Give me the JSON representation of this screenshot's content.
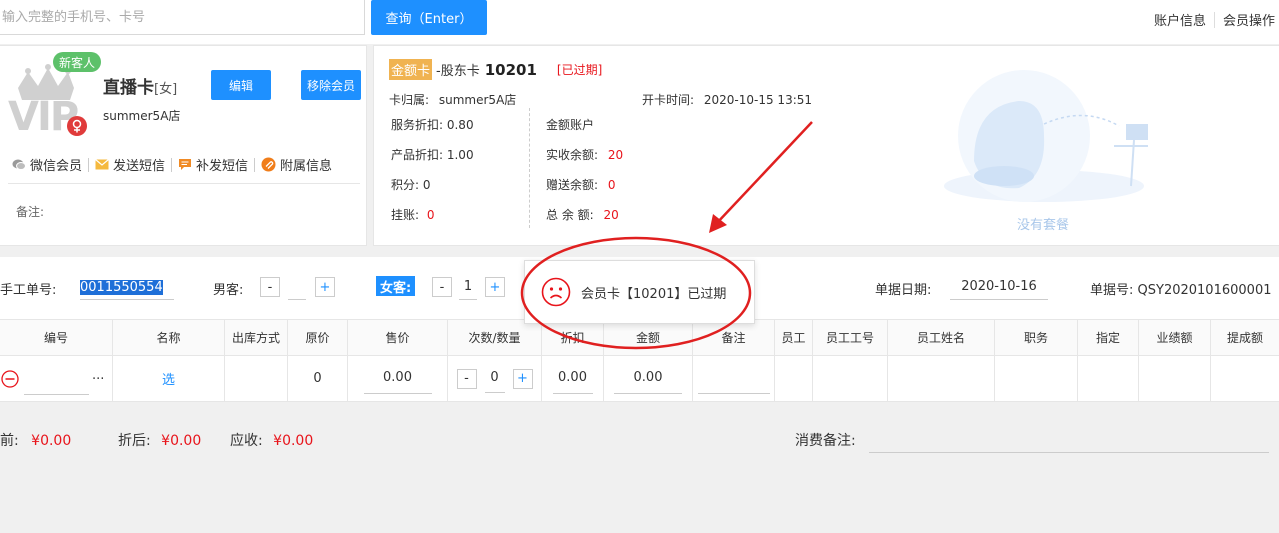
{
  "topbar": {
    "search_placeholder": "输入完整的手机号、卡号",
    "query_button": "查询（Enter）",
    "links": [
      "账户信息",
      "会员操作"
    ]
  },
  "member": {
    "badge": "新客人",
    "logo_text": "VIP",
    "name": "直播卡",
    "gender": "[女]",
    "store": "summer5A店",
    "edit_button": "编辑",
    "remove_button": "移除会员",
    "actions": [
      "微信会员",
      "发送短信",
      "补发短信",
      "附属信息"
    ],
    "remark_label": "备注:"
  },
  "card": {
    "type_tag": "金额卡",
    "card_class": "-股东卡",
    "card_no": "10201",
    "status": "[已过期]",
    "belong_label": "卡归属:",
    "belong_value": "summer5A店",
    "open_time_label": "开卡时间:",
    "open_time_value": "2020-10-15 13:51",
    "service_discount": "服务折扣: 0.80",
    "product_discount": "产品折扣: 1.00",
    "points": "积分: 0",
    "debt_label": "挂账:",
    "debt_value": "0",
    "account_title": "金额账户",
    "paid_label": "实收余额:",
    "paid_value": "20",
    "gift_label": "赠送余额:",
    "gift_value": "0",
    "total_label": "总 余 额:",
    "total_value": "20",
    "no_package": "没有套餐"
  },
  "form": {
    "manual_label": "手工单号:",
    "manual_value": "0011550554",
    "male_label": "男客:",
    "male_value": "",
    "female_label": "女客:",
    "female_value": "1",
    "minus": "-",
    "plus": "+",
    "date_label": "单据日期:",
    "date_value": "2020-10-16",
    "bill_label": "单据号:",
    "bill_value": "QSY2020101600001"
  },
  "table": {
    "headers": [
      "编号",
      "名称",
      "出库方式",
      "原价",
      "售价",
      "次数/数量",
      "折扣",
      "金额",
      "备注",
      "员工",
      "员工工号",
      "员工姓名",
      "职务",
      "指定",
      "业绩额",
      "提成额"
    ],
    "row": {
      "more": "...",
      "name": "选",
      "original_price": "0",
      "sale_price": "0.00",
      "qty": "0",
      "discount": "0.00",
      "amount": "0.00"
    }
  },
  "totals": {
    "before_label": "前:",
    "before_value": "¥0.00",
    "after_label": "折后:",
    "after_value": "¥0.00",
    "due_label": "应收:",
    "due_value": "¥0.00",
    "remark_label": "消费备注:"
  },
  "popup": {
    "message": "会员卡【10201】已过期"
  },
  "colors": {
    "primary": "#1e90ff",
    "danger": "#e8141b",
    "tag": "#f0b351",
    "annotation": "#e02020"
  }
}
